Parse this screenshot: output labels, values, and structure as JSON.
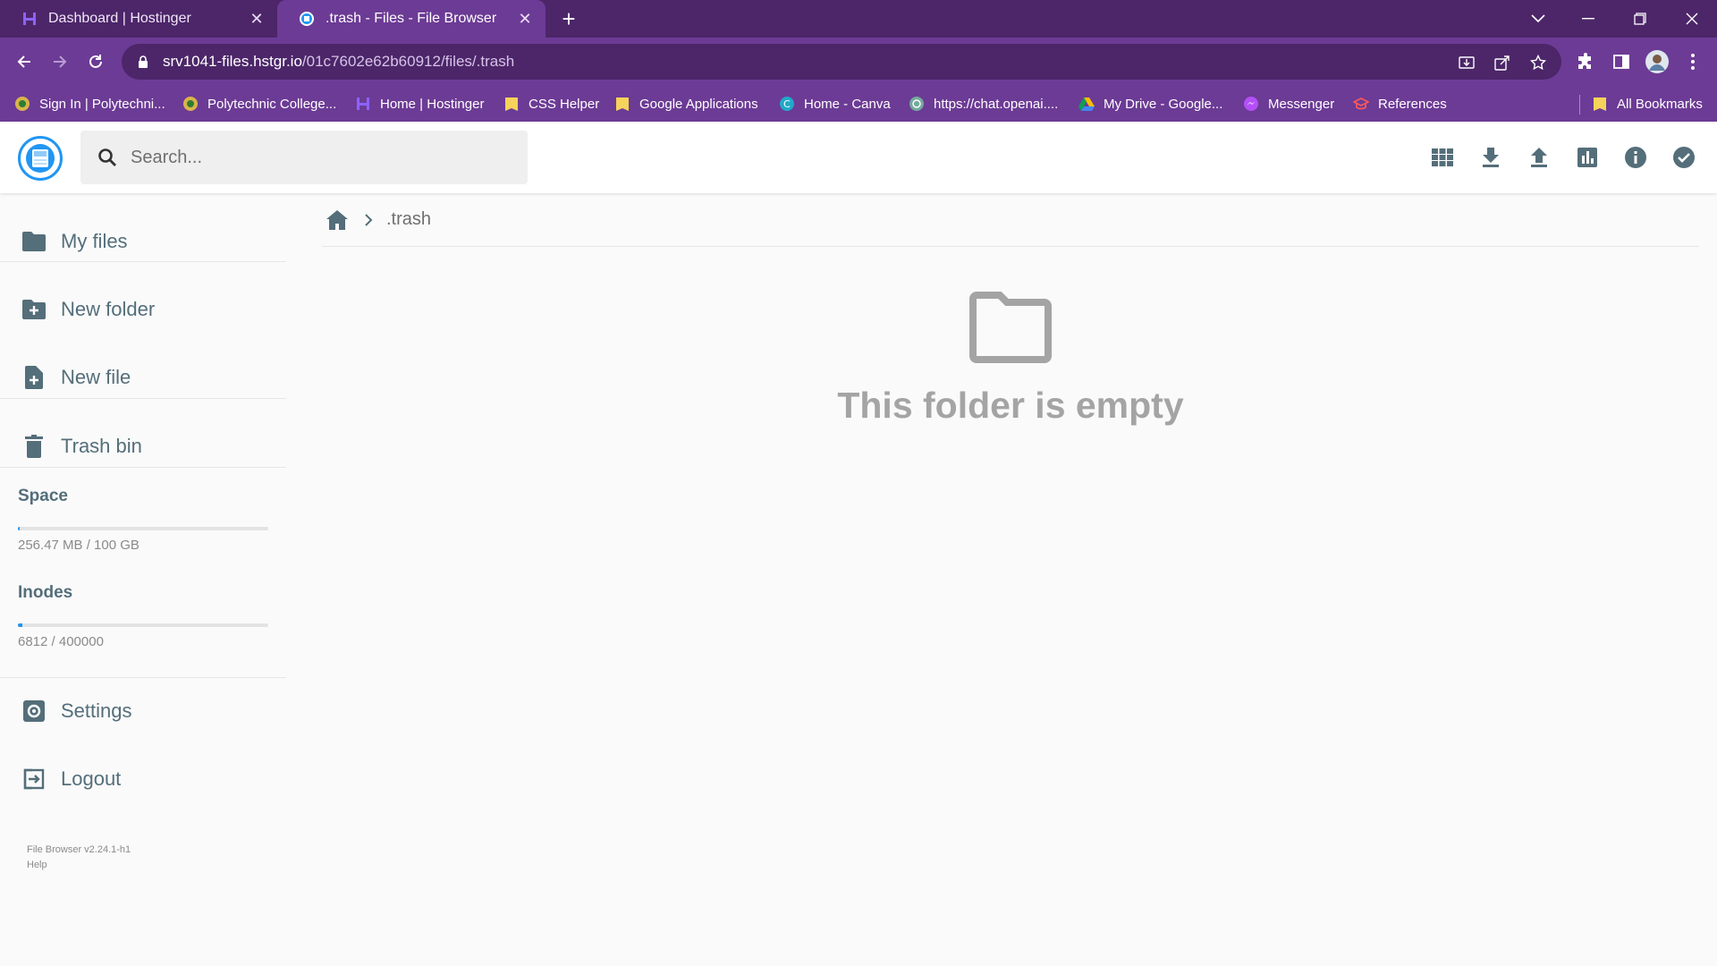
{
  "browser": {
    "tabs": [
      {
        "title": "Dashboard | Hostinger",
        "active": false,
        "icon": "hostinger-icon"
      },
      {
        "title": ".trash - Files - File Browser",
        "active": true,
        "icon": "filebrowser-icon"
      }
    ],
    "url_host": "srv1041-files.hstgr.io",
    "url_path": "/01c7602e62b60912/files/.trash",
    "bookmarks": [
      {
        "label": "Sign In | Polytechni...",
        "icon": "polytechnic-icon"
      },
      {
        "label": "Polytechnic College...",
        "icon": "polytechnic-icon"
      },
      {
        "label": "Home | Hostinger",
        "icon": "hostinger-icon"
      },
      {
        "label": "CSS Helper",
        "icon": "folder-icon"
      },
      {
        "label": "Google Applications",
        "icon": "folder-icon"
      },
      {
        "label": "Home - Canva",
        "icon": "canva-icon"
      },
      {
        "label": "https://chat.openai....",
        "icon": "openai-icon"
      },
      {
        "label": "My Drive - Google...",
        "icon": "google-drive-icon"
      },
      {
        "label": "Messenger",
        "icon": "messenger-icon"
      },
      {
        "label": "References",
        "icon": "references-icon"
      }
    ],
    "all_bookmarks": "All Bookmarks",
    "colors": {
      "frame": "#4c2669",
      "toolbar": "#6c3b95"
    }
  },
  "app": {
    "search": {
      "placeholder": "Search..."
    },
    "header_actions": [
      "grid-view-icon",
      "download-icon",
      "upload-icon",
      "chart-icon",
      "info-icon",
      "check-circle-icon"
    ],
    "sidebar": {
      "my_files": "My files",
      "new_folder": "New folder",
      "new_file": "New file",
      "trash_bin": "Trash bin",
      "space": {
        "title": "Space",
        "text": "256.47 MB / 100 GB",
        "fraction": 0.0025
      },
      "inodes": {
        "title": "Inodes",
        "text": "6812 / 400000",
        "fraction": 0.017
      },
      "settings": "Settings",
      "logout": "Logout",
      "footer_version": "File Browser v2.24.1-h1",
      "footer_help": "Help"
    },
    "breadcrumb": {
      "current": ".trash"
    },
    "empty_message": "This folder is empty",
    "colors": {
      "accent": "#2196f3",
      "text": "#546e7a",
      "muted": "#a4a4a4"
    }
  }
}
